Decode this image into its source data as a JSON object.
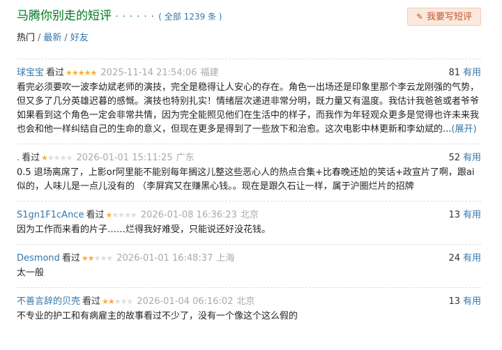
{
  "header": {
    "title": "马腾你别走的短评",
    "dots": "· · · · · ·",
    "total": "( 全部 1239 条 )",
    "write_button": "我要写短评"
  },
  "filters": {
    "hot": "热门",
    "latest": "最新",
    "friends": "好友"
  },
  "comments": [
    {
      "user": "球宝宝",
      "status": "看过",
      "rating": 5,
      "time": "2025-11-14 21:54:06",
      "location": "福建",
      "useful_count": "81",
      "useful_label": "有用",
      "text": "看完必须要吹一波李幼斌老师的演技，完全是稳得让人安心的存在。角色一出场还是印象里那个李云龙刚强的气势，但又多了几分英雄迟暮的感慨。演技也特别扎实！情绪层次递进非常分明，既力量又有温度。我估计我爸爸或者爷爷如果看到这个角色一定会非常共情，因为完全能照见他们在生活中的样子，而我作为年轻观众更多是觉得也许未来我也会和他一样纠结自己的生命的意义，但现在更多是得到了一些放下和治愈。这次电影中林更新和李幼斌的...",
      "expand": "(展开)"
    },
    {
      "user": ".",
      "status": "看过",
      "rating": 1,
      "time": "2026-01-01 15:11:25",
      "location": "广东",
      "useful_count": "52",
      "useful_label": "有用",
      "text": "0.5 退场离席了，上影or阿里能不能别每年搁这儿整这些恶心人的热点合集+比春晚还尬的笑话+政宣片了啊，跟ai似的，人味儿是一点儿没有的 （李屏宾又在赚黑心钱。。现在是跟久石让一样，属于沪圈烂片的招牌",
      "expand": ""
    },
    {
      "user": "S1gn1F1cAnce",
      "status": "看过",
      "rating": 1,
      "time": "2026-01-08 16:36:23",
      "location": "北京",
      "useful_count": "13",
      "useful_label": "有用",
      "text": "因为工作而来看的片子……烂得我好难受，只能说还好没花钱。",
      "expand": ""
    },
    {
      "user": "Desmond",
      "status": "看过",
      "rating": 2,
      "time": "2026-01-01 16:48:37",
      "location": "上海",
      "useful_count": "24",
      "useful_label": "有用",
      "text": "太一般",
      "expand": ""
    },
    {
      "user": "不善言辞的贝壳",
      "status": "看过",
      "rating": 2,
      "time": "2026-01-04 06:16:02",
      "location": "北京",
      "useful_count": "13",
      "useful_label": "有用",
      "text": "不专业的护工和有病雇主的故事看过不少了，没有一个像这个这么假的",
      "expand": ""
    }
  ],
  "colors": {
    "title_green": "#007722",
    "link_blue": "#3377aa",
    "star_on": "#ffac2d",
    "star_off": "#dddddd",
    "button_bg": "#fbe9de",
    "button_text": "#c7532c"
  },
  "icons": {
    "write": "pencil-icon",
    "star": "star-icon"
  }
}
